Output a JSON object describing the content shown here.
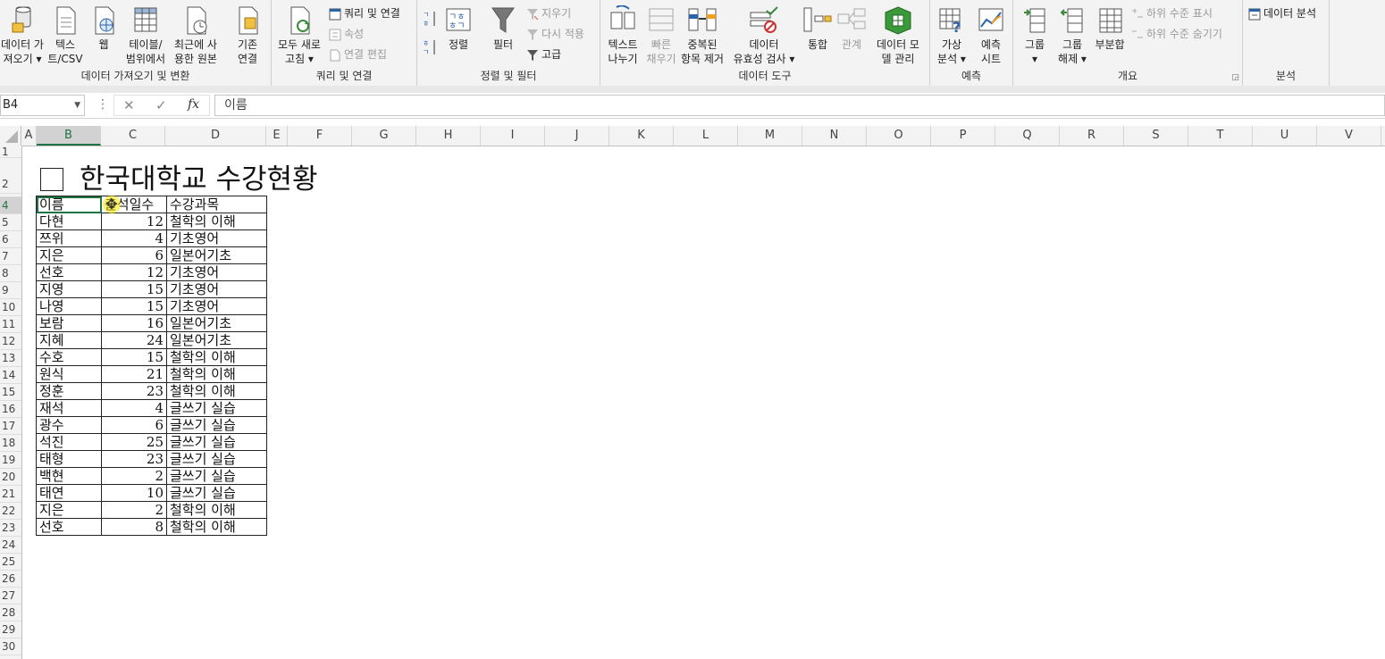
{
  "ribbon": {
    "groups": {
      "get_transform": "데이터 가져오기 및 변환",
      "queries": "쿼리 및 연결",
      "sort_filter": "정렬 및 필터",
      "data_tools": "데이터 도구",
      "forecast": "예측",
      "outline": "개요",
      "analysis": "분석"
    },
    "buttons": {
      "get_data_1": "데이터 가",
      "get_data_2": "져오기 ▾",
      "text_csv_1": "텍스",
      "text_csv_2": "트/CSV",
      "web": "웹",
      "table_range_1": "테이블/",
      "table_range_2": "범위에서",
      "recent_1": "최근에 사",
      "recent_2": "용한 원본",
      "existing_1": "기존",
      "existing_2": "연결",
      "refresh_1": "모두 새로",
      "refresh_2": "고침 ▾",
      "queries_connections": "쿼리 및 연결",
      "properties": "속성",
      "edit_links": "연결 편집",
      "sort": "정렬",
      "filter": "필터",
      "clear": "지우기",
      "reapply": "다시 적용",
      "advanced": "고급",
      "text_columns_1": "텍스트",
      "text_columns_2": "나누기",
      "flash_fill_1": "빠른",
      "flash_fill_2": "채우기",
      "remove_dup_1": "중복된",
      "remove_dup_2": "항목 제거",
      "validation_1": "데이터",
      "validation_2": "유효성 검사 ▾",
      "consolidate": "통합",
      "relationships": "관계",
      "data_model_1": "데이터 모",
      "data_model_2": "델 관리",
      "whatif_1": "가상",
      "whatif_2": "분석 ▾",
      "forecast_1": "예측",
      "forecast_2": "시트",
      "group_1": "그룹",
      "group_2": "▾",
      "ungroup_1": "그룹",
      "ungroup_2": "해제 ▾",
      "subtotal": "부분합",
      "show_detail": "하위 수준 표시",
      "hide_detail": "하위 수준 숨기기",
      "data_analysis": "데이터 분석"
    }
  },
  "formula_bar": {
    "name_box": "B4",
    "formula": "이름"
  },
  "columns": [
    "A",
    "B",
    "C",
    "D",
    "E",
    "F",
    "G",
    "H",
    "I",
    "J",
    "K",
    "L",
    "M",
    "N",
    "O",
    "P",
    "Q",
    "R",
    "S",
    "T",
    "U",
    "V"
  ],
  "rows": [
    "1",
    "2",
    "",
    "4",
    "5",
    "6",
    "7",
    "8",
    "9",
    "10",
    "11",
    "12",
    "13",
    "14",
    "15",
    "16",
    "17",
    "18",
    "19",
    "20",
    "21",
    "22",
    "23",
    "24",
    "25",
    "26",
    "27",
    "28",
    "29",
    "30"
  ],
  "sheet": {
    "title": "한국대학교 수강현황",
    "headers": [
      "이름",
      "출석일수",
      "수강과목"
    ],
    "records": [
      [
        "다현",
        "12",
        "철학의 이해"
      ],
      [
        "쯔위",
        "4",
        "기초영어"
      ],
      [
        "지은",
        "6",
        "일본어기초"
      ],
      [
        "선호",
        "12",
        "기초영어"
      ],
      [
        "지영",
        "15",
        "기초영어"
      ],
      [
        "나영",
        "15",
        "기초영어"
      ],
      [
        "보람",
        "16",
        "일본어기초"
      ],
      [
        "지혜",
        "24",
        "일본어기초"
      ],
      [
        "수호",
        "15",
        "철학의 이해"
      ],
      [
        "원식",
        "21",
        "철학의 이해"
      ],
      [
        "정훈",
        "23",
        "철학의 이해"
      ],
      [
        "재석",
        "4",
        "글쓰기 실습"
      ],
      [
        "광수",
        "6",
        "글쓰기 실습"
      ],
      [
        "석진",
        "25",
        "글쓰기 실습"
      ],
      [
        "태형",
        "23",
        "글쓰기 실습"
      ],
      [
        "백현",
        "2",
        "글쓰기 실습"
      ],
      [
        "태연",
        "10",
        "글쓰기 실습"
      ],
      [
        "지은",
        "2",
        "철학의 이해"
      ],
      [
        "선호",
        "8",
        "철학의 이해"
      ]
    ]
  },
  "colors": {
    "accent": "#217346"
  }
}
